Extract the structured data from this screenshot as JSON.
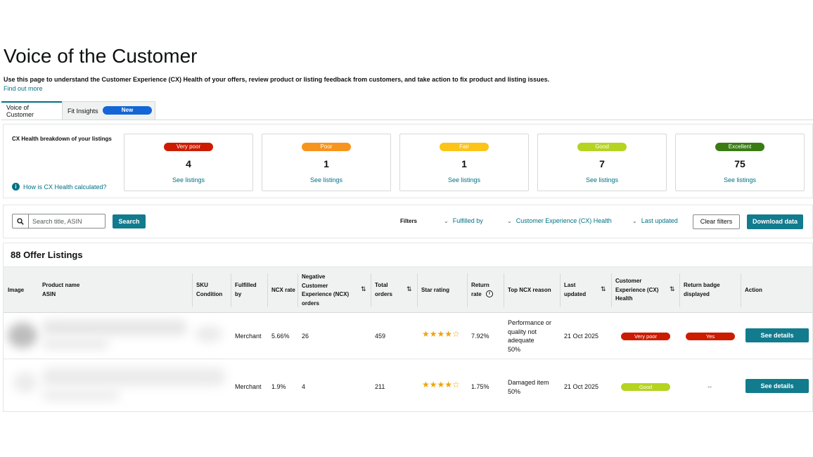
{
  "page": {
    "title": "Voice of the Customer",
    "description": "Use this page to understand the Customer Experience (CX) Health of your offers, review product or listing feedback from customers, and take action to fix product and listing issues.",
    "find_out_more": "Find out more"
  },
  "tabs": [
    {
      "label": "Voice of Customer",
      "active": true
    },
    {
      "label": "Fit Insights",
      "badge": "New"
    }
  ],
  "cx_health": {
    "label": "CX Health breakdown of your listings",
    "how_link": "How is CX Health calculated?",
    "cards": [
      {
        "label": "Very poor",
        "count": "4",
        "link": "See listings",
        "color": "#cc1c00"
      },
      {
        "label": "Poor",
        "count": "1",
        "link": "See listings",
        "color": "#f7941d"
      },
      {
        "label": "Fair",
        "count": "1",
        "link": "See listings",
        "color": "#fcc419"
      },
      {
        "label": "Good",
        "count": "7",
        "link": "See listings",
        "color": "#b5d321"
      },
      {
        "label": "Excellent",
        "count": "75",
        "link": "See listings",
        "color": "#3a7b14"
      }
    ]
  },
  "filters": {
    "search_placeholder": "Search title, ASIN",
    "search_button": "Search",
    "filters_label": "Filters",
    "dropdowns": [
      "Fulfilled by",
      "Customer Experience (CX) Health",
      "Last updated"
    ],
    "clear_button": "Clear filters",
    "download_button": "Download data"
  },
  "listings": {
    "title": "88 Offer Listings",
    "headers": {
      "image": "Image",
      "product_name": "Product name",
      "asin": "ASIN",
      "sku": "SKU",
      "condition": "Condition",
      "fulfilled_by_1": "Fulfilled",
      "fulfilled_by_2": "by",
      "ncx_rate": "NCX rate",
      "ncx_orders_1": "Negative",
      "ncx_orders_2": "Customer",
      "ncx_orders_3": "Experience (NCX)",
      "ncx_orders_4": "orders",
      "total_orders_1": "Total",
      "total_orders_2": "orders",
      "star_rating": "Star rating",
      "return_rate_1": "Return",
      "return_rate_2": "rate",
      "top_reason": "Top NCX reason",
      "last_updated_1": "Last",
      "last_updated_2": "updated",
      "cx_health_1": "Customer",
      "cx_health_2": "Experience (CX)",
      "cx_health_3": "Health",
      "return_badge_1": "Return badge",
      "return_badge_2": "displayed",
      "action": "Action"
    },
    "rows": [
      {
        "fulfilled_by": "Merchant",
        "ncx_rate": "5.66%",
        "ncx_orders": "26",
        "total_orders": "459",
        "stars": "★★★★☆",
        "star_rating": 4.5,
        "return_rate": "7.92%",
        "reason_1": "Performance or",
        "reason_2": "quality not",
        "reason_3": "adequate",
        "reason_pct": "50%",
        "last_updated": "21 Oct 2025",
        "cx_health": "Very poor",
        "cx_color": "#cc1c00",
        "return_badge": "Yes",
        "action": "See details"
      },
      {
        "fulfilled_by": "Merchant",
        "ncx_rate": "1.9%",
        "ncx_orders": "4",
        "total_orders": "211",
        "stars": "★★★★☆",
        "star_rating": 4.5,
        "return_rate": "1.75%",
        "reason_1": "Damaged item",
        "reason_pct": "50%",
        "last_updated": "21 Oct 2025",
        "cx_health": "Good",
        "cx_color": "#b5d321",
        "return_badge": "--",
        "action": "See details"
      }
    ]
  }
}
